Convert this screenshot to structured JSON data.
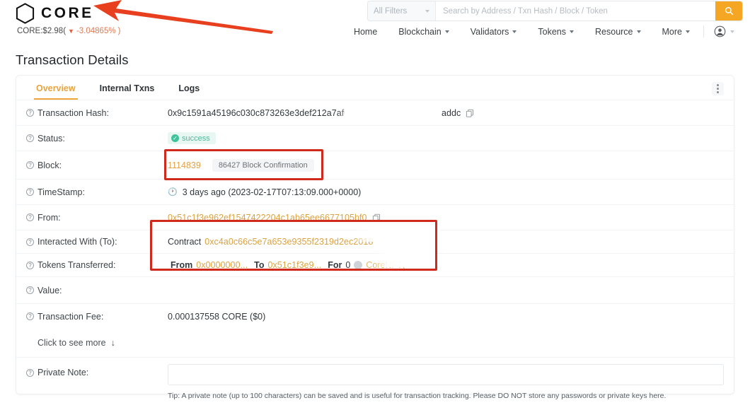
{
  "header": {
    "brand_name": "CORE",
    "logo_icon": "hexagon-logo-icon",
    "ticker": {
      "price_label": "CORE:$2.98(",
      "change": "-3.04865%",
      "suffix": ")",
      "direction_icon": "caret-down-icon"
    },
    "search": {
      "filter_label": "All Filters",
      "filter_caret_icon": "chevron-down-icon",
      "placeholder": "Search by Address / Txn Hash / Block / Token",
      "value": "",
      "button_icon": "search-icon",
      "button_color": "#f5a623"
    },
    "nav": [
      {
        "label": "Home",
        "has_caret": false
      },
      {
        "label": "Blockchain",
        "has_caret": true
      },
      {
        "label": "Validators",
        "has_caret": true
      },
      {
        "label": "Tokens",
        "has_caret": true
      },
      {
        "label": "Resource",
        "has_caret": true
      },
      {
        "label": "More",
        "has_caret": true
      }
    ],
    "account": {
      "icon": "user-avatar-icon",
      "caret_icon": "chevron-down-icon"
    }
  },
  "page": {
    "title": "Transaction Details"
  },
  "card": {
    "tabs": [
      {
        "label": "Overview",
        "active": true
      },
      {
        "label": "Internal Txns",
        "active": false
      },
      {
        "label": "Logs",
        "active": false
      }
    ],
    "menu_icon": "kebab-menu-icon"
  },
  "details": {
    "tx_hash": {
      "label": "Transaction Hash:",
      "value": "0x9c1591a45196c030c873263e3def212a7af0d",
      "value_tail": "addc",
      "copy_icon": "copy-icon"
    },
    "status": {
      "label": "Status:",
      "value": "success",
      "icon": "check-circle-icon",
      "color": "#4fb89a",
      "background": "#e8f7f1"
    },
    "block": {
      "label": "Block:",
      "number": "1114839",
      "confirmations": "86427 Block Confirmation"
    },
    "timestamp": {
      "label": "TimeStamp:",
      "icon": "clock-icon",
      "value": "3 days ago (2023-02-17T07:13:09.000+0000)"
    },
    "from": {
      "label": "From:",
      "address": "0x51c1f3e962ef1547422204c1ab65ee6677105bf0",
      "copy_icon": "copy-icon"
    },
    "interacted_with": {
      "label": "Interacted With (To):",
      "prefix": "Contract",
      "address": "0xc4a0c66c5e7a653e9355f2319d2ec2018"
    },
    "tokens_transferred": {
      "label": "Tokens Transferred:",
      "from_label": "From",
      "from_value": "0x0000000...",
      "to_label": "To",
      "to_value": "0x51c1f3e9...",
      "for_label": "For",
      "for_amount": "0",
      "token_icon": "token-avatar-icon",
      "token_name": "CoreNFT("
    },
    "value": {
      "label": "Value:",
      "value": ""
    },
    "tx_fee": {
      "label": "Transaction Fee:",
      "value": "0.000137558 CORE ($0)"
    },
    "see_more": {
      "label": "Click to see more",
      "icon": "arrow-down-icon"
    },
    "private_note": {
      "label": "Private Note:",
      "value": "",
      "placeholder": "",
      "tip": "Tip: A private note (up to 100 characters) can be saved and is useful for transaction tracking. Please DO NOT store any passwords or private keys here."
    }
  },
  "annotations": {
    "color": "#cf2a1b",
    "arrow": {
      "name": "red-pointer-arrow",
      "points_to": "brand-logo"
    },
    "boxes": [
      {
        "name": "highlight-box-block",
        "target": "block-row"
      },
      {
        "name": "highlight-box-contract-and-tokens",
        "target": "interacted-with-and-tokens-rows"
      }
    ]
  }
}
